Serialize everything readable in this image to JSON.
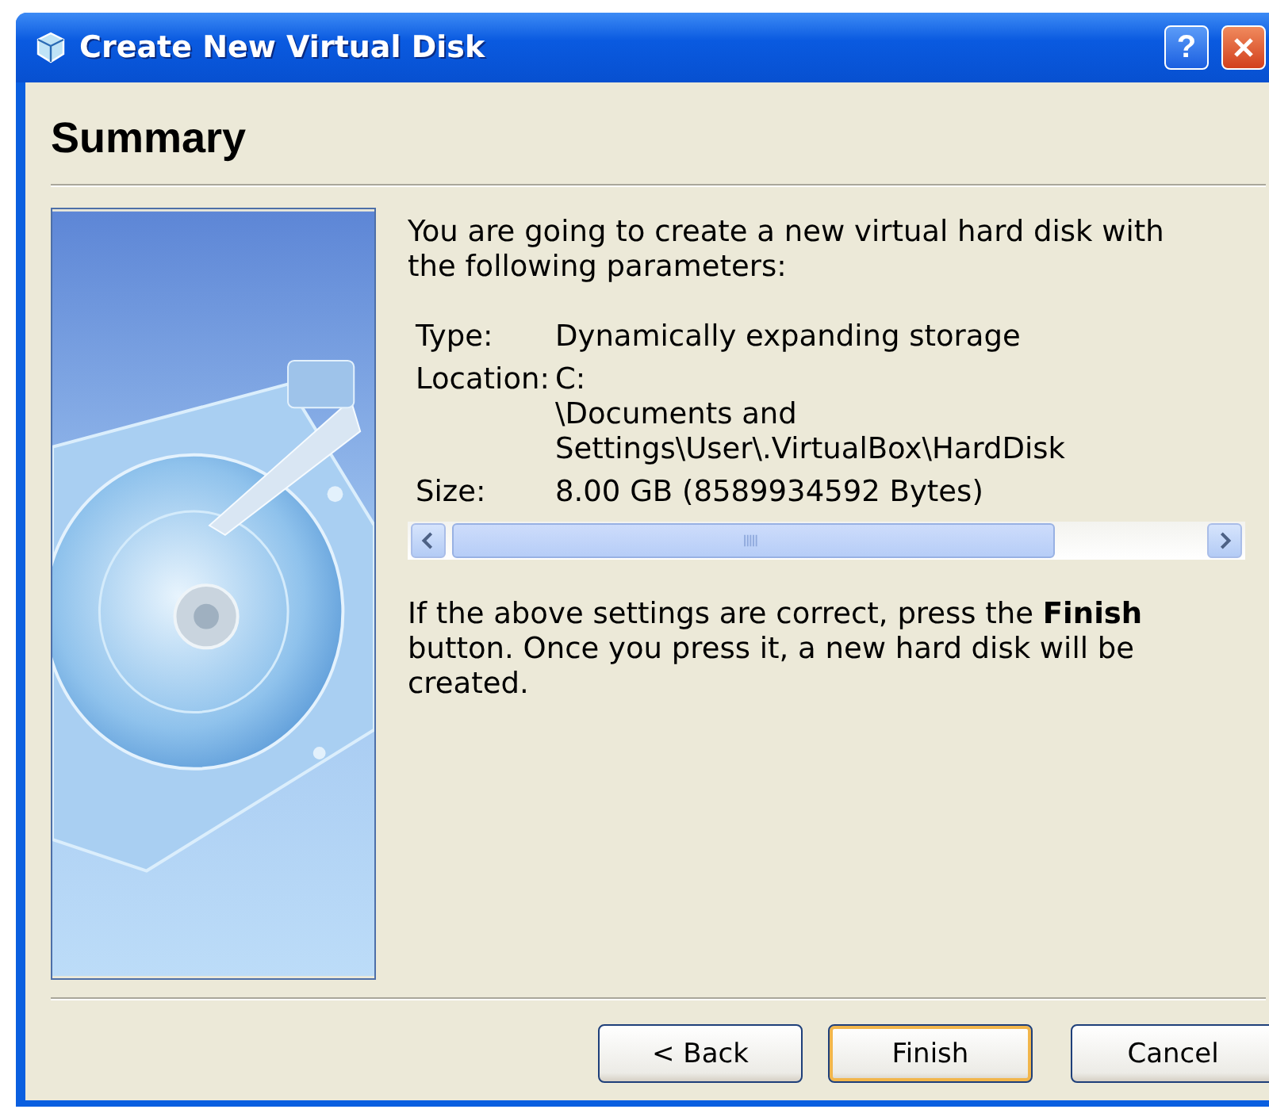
{
  "window": {
    "title": "Create New Virtual Disk",
    "controls": [
      {
        "kind": "help",
        "label": "?"
      },
      {
        "kind": "close"
      }
    ]
  },
  "page": {
    "heading": "Summary",
    "intro": "You are going to create a new virtual hard disk with the following parameters:",
    "details": [
      {
        "label": "Type:",
        "value": "Dynamically expanding storage"
      },
      {
        "label": "Location:",
        "value": "C:\n\\Documents and Settings\\User\\.VirtualBox\\HardDisk"
      },
      {
        "label": "Size:",
        "value": "8.00 GB (8589934592 Bytes)"
      }
    ],
    "note": "If the above settings are correct, press the **Finish** button. Once you press it, a new hard disk will be created."
  },
  "buttons": [
    {
      "label": "< Back",
      "default": false
    },
    {
      "label": "Finish",
      "default": true
    },
    {
      "label": "Cancel",
      "default": false
    }
  ]
}
